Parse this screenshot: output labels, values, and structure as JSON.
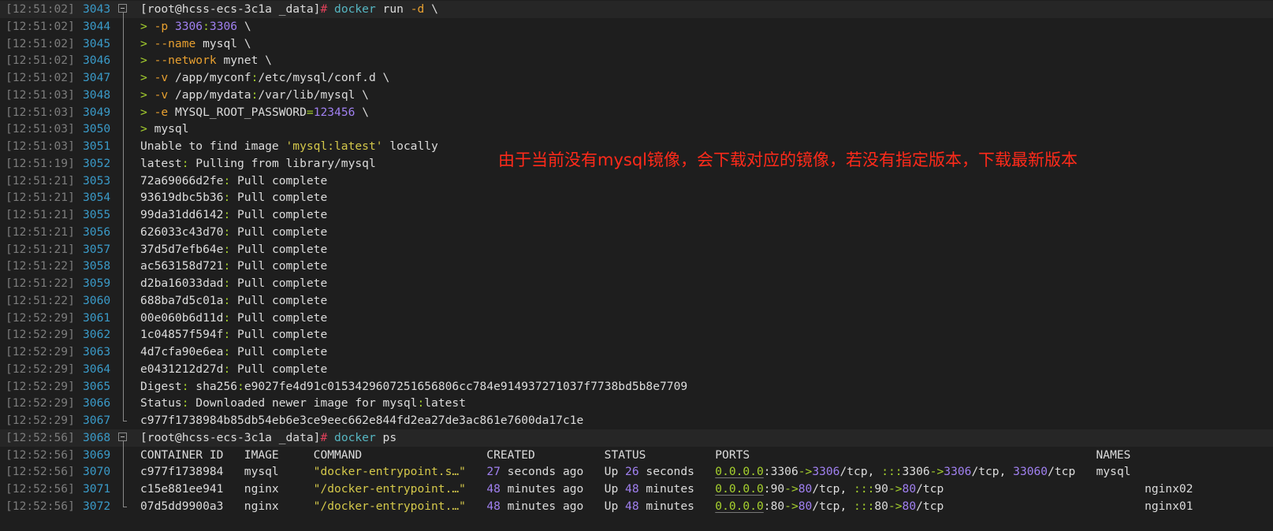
{
  "colors": {
    "background": "#1e1e1e",
    "timestamp": "#7c7c7c",
    "line_number": "#3a9ac8",
    "annotation": "#ff2a1a"
  },
  "annotation": "由于当前没有mysql镜像，会下载对应的镜像，若没有指定版本，下载最新版本",
  "lines": [
    {
      "ts": "[12:51:02]",
      "n": "3043",
      "fold": "start",
      "prompt": true,
      "seg": [
        [
          "[root@hcss-ecs-3c1a _data]",
          "w"
        ],
        [
          "#",
          "r"
        ],
        [
          " docker",
          "c"
        ],
        [
          " run ",
          "w"
        ],
        [
          "-d",
          "o"
        ],
        [
          " \\",
          "w"
        ]
      ]
    },
    {
      "ts": "[12:51:02]",
      "n": "3044",
      "fold": "mid",
      "seg": [
        [
          "> ",
          "g"
        ],
        [
          "-p",
          "o"
        ],
        [
          " ",
          "w"
        ],
        [
          "3306",
          "p"
        ],
        [
          ":",
          "g"
        ],
        [
          "3306",
          "p"
        ],
        [
          " \\",
          "w"
        ]
      ]
    },
    {
      "ts": "[12:51:02]",
      "n": "3045",
      "fold": "mid",
      "seg": [
        [
          "> ",
          "g"
        ],
        [
          "--name",
          "o"
        ],
        [
          " mysql \\",
          "w"
        ]
      ]
    },
    {
      "ts": "[12:51:02]",
      "n": "3046",
      "fold": "mid",
      "seg": [
        [
          "> ",
          "g"
        ],
        [
          "--network",
          "o"
        ],
        [
          " mynet \\",
          "w"
        ]
      ]
    },
    {
      "ts": "[12:51:02]",
      "n": "3047",
      "fold": "mid",
      "seg": [
        [
          "> ",
          "g"
        ],
        [
          "-v",
          "o"
        ],
        [
          " /app/myconf",
          "w"
        ],
        [
          ":",
          "g"
        ],
        [
          "/etc/mysql/conf.d \\",
          "w"
        ]
      ]
    },
    {
      "ts": "[12:51:03]",
      "n": "3048",
      "fold": "mid",
      "seg": [
        [
          "> ",
          "g"
        ],
        [
          "-v",
          "o"
        ],
        [
          " /app/mydata",
          "w"
        ],
        [
          ":",
          "g"
        ],
        [
          "/var/lib/mysql \\",
          "w"
        ]
      ]
    },
    {
      "ts": "[12:51:03]",
      "n": "3049",
      "fold": "mid",
      "seg": [
        [
          "> ",
          "g"
        ],
        [
          "-e",
          "o"
        ],
        [
          " MYSQL_ROOT_PASSWORD",
          "w"
        ],
        [
          "=",
          "g"
        ],
        [
          "123456",
          "p"
        ],
        [
          " \\",
          "w"
        ]
      ]
    },
    {
      "ts": "[12:51:03]",
      "n": "3050",
      "fold": "mid",
      "seg": [
        [
          "> ",
          "g"
        ],
        [
          "mysql",
          "w"
        ]
      ]
    },
    {
      "ts": "[12:51:03]",
      "n": "3051",
      "fold": "mid",
      "seg": [
        [
          "Unable to find image ",
          "w"
        ],
        [
          "'mysql:latest'",
          "y"
        ],
        [
          " locally",
          "w"
        ]
      ]
    },
    {
      "ts": "[12:51:19]",
      "n": "3052",
      "fold": "mid",
      "seg": [
        [
          "latest",
          "w"
        ],
        [
          ":",
          "g"
        ],
        [
          " Pulling from library/mysql",
          "w"
        ]
      ]
    },
    {
      "ts": "[12:51:21]",
      "n": "3053",
      "fold": "mid",
      "seg": [
        [
          "72a69066d2fe",
          "w"
        ],
        [
          ":",
          "g"
        ],
        [
          " Pull complete",
          "w"
        ]
      ]
    },
    {
      "ts": "[12:51:21]",
      "n": "3054",
      "fold": "mid",
      "seg": [
        [
          "93619dbc5b36",
          "w"
        ],
        [
          ":",
          "g"
        ],
        [
          " Pull complete",
          "w"
        ]
      ]
    },
    {
      "ts": "[12:51:21]",
      "n": "3055",
      "fold": "mid",
      "seg": [
        [
          "99da31dd6142",
          "w"
        ],
        [
          ":",
          "g"
        ],
        [
          " Pull complete",
          "w"
        ]
      ]
    },
    {
      "ts": "[12:51:21]",
      "n": "3056",
      "fold": "mid",
      "seg": [
        [
          "626033c43d70",
          "w"
        ],
        [
          ":",
          "g"
        ],
        [
          " Pull complete",
          "w"
        ]
      ]
    },
    {
      "ts": "[12:51:21]",
      "n": "3057",
      "fold": "mid",
      "seg": [
        [
          "37d5d7efb64e",
          "w"
        ],
        [
          ":",
          "g"
        ],
        [
          " Pull complete",
          "w"
        ]
      ]
    },
    {
      "ts": "[12:51:22]",
      "n": "3058",
      "fold": "mid",
      "seg": [
        [
          "ac563158d721",
          "w"
        ],
        [
          ":",
          "g"
        ],
        [
          " Pull complete",
          "w"
        ]
      ]
    },
    {
      "ts": "[12:51:22]",
      "n": "3059",
      "fold": "mid",
      "seg": [
        [
          "d2ba16033dad",
          "w"
        ],
        [
          ":",
          "g"
        ],
        [
          " Pull complete",
          "w"
        ]
      ]
    },
    {
      "ts": "[12:51:22]",
      "n": "3060",
      "fold": "mid",
      "seg": [
        [
          "688ba7d5c01a",
          "w"
        ],
        [
          ":",
          "g"
        ],
        [
          " Pull complete",
          "w"
        ]
      ]
    },
    {
      "ts": "[12:52:29]",
      "n": "3061",
      "fold": "mid",
      "seg": [
        [
          "00e060b6d11d",
          "w"
        ],
        [
          ":",
          "g"
        ],
        [
          " Pull complete",
          "w"
        ]
      ]
    },
    {
      "ts": "[12:52:29]",
      "n": "3062",
      "fold": "mid",
      "seg": [
        [
          "1c04857f594f",
          "w"
        ],
        [
          ":",
          "g"
        ],
        [
          " Pull complete",
          "w"
        ]
      ]
    },
    {
      "ts": "[12:52:29]",
      "n": "3063",
      "fold": "mid",
      "seg": [
        [
          "4d7cfa90e6ea",
          "w"
        ],
        [
          ":",
          "g"
        ],
        [
          " Pull complete",
          "w"
        ]
      ]
    },
    {
      "ts": "[12:52:29]",
      "n": "3064",
      "fold": "mid",
      "seg": [
        [
          "e0431212d27d",
          "w"
        ],
        [
          ":",
          "g"
        ],
        [
          " Pull complete",
          "w"
        ]
      ]
    },
    {
      "ts": "[12:52:29]",
      "n": "3065",
      "fold": "mid",
      "seg": [
        [
          "Digest",
          "w"
        ],
        [
          ":",
          "g"
        ],
        [
          " sha256",
          "w"
        ],
        [
          ":",
          "g"
        ],
        [
          "e9027fe4d91c0153429607251656806cc784e914937271037f7738bd5b8e7709",
          "w"
        ]
      ]
    },
    {
      "ts": "[12:52:29]",
      "n": "3066",
      "fold": "mid",
      "seg": [
        [
          "Status",
          "w"
        ],
        [
          ":",
          "g"
        ],
        [
          " Downloaded newer image for mysql",
          "w"
        ],
        [
          ":",
          "g"
        ],
        [
          "latest",
          "w"
        ]
      ]
    },
    {
      "ts": "[12:52:29]",
      "n": "3067",
      "fold": "end",
      "seg": [
        [
          "c977f1738984b85db54eb6e3ce9eec662e844fd2ea27de3ac861e7600da17c1e",
          "w"
        ]
      ]
    },
    {
      "ts": "[12:52:56]",
      "n": "3068",
      "fold": "start",
      "prompt": true,
      "seg": [
        [
          "[root@hcss-ecs-3c1a _data]",
          "w"
        ],
        [
          "#",
          "r"
        ],
        [
          " docker",
          "c"
        ],
        [
          " ps",
          "w"
        ]
      ]
    },
    {
      "ts": "[12:52:56]",
      "n": "3069",
      "fold": "mid",
      "seg": [
        [
          "CONTAINER ID   IMAGE     COMMAND                  CREATED          STATUS          PORTS                                                  NAMES",
          "w"
        ]
      ]
    },
    {
      "ts": "[12:52:56]",
      "n": "3070",
      "fold": "mid",
      "seg": [
        [
          "c977f1738984   mysql     ",
          "w"
        ],
        [
          "\"docker-entrypoint.s…\"",
          "y"
        ],
        [
          "   ",
          "w"
        ],
        [
          "27",
          "p"
        ],
        [
          " seconds ago   Up ",
          "w"
        ],
        [
          "26",
          "p"
        ],
        [
          " seconds   ",
          "w"
        ],
        [
          "0.0.0.0",
          "u"
        ],
        [
          ":3306",
          "w"
        ],
        [
          "->",
          "g"
        ],
        [
          "3306",
          "p"
        ],
        [
          "/tcp, ",
          "w"
        ],
        [
          ":::",
          "g"
        ],
        [
          "3306",
          "w"
        ],
        [
          "->",
          "g"
        ],
        [
          "3306",
          "p"
        ],
        [
          "/tcp, ",
          "w"
        ],
        [
          "33060",
          "p"
        ],
        [
          "/tcp   mysql",
          "w"
        ]
      ]
    },
    {
      "ts": "[12:52:56]",
      "n": "3071",
      "fold": "mid",
      "seg": [
        [
          "c15e881ee941   nginx     ",
          "w"
        ],
        [
          "\"/docker-entrypoint.…\"",
          "y"
        ],
        [
          "   ",
          "w"
        ],
        [
          "48",
          "p"
        ],
        [
          " minutes ago   Up ",
          "w"
        ],
        [
          "48",
          "p"
        ],
        [
          " minutes   ",
          "w"
        ],
        [
          "0.0.0.0",
          "u"
        ],
        [
          ":90",
          "w"
        ],
        [
          "->",
          "g"
        ],
        [
          "80",
          "p"
        ],
        [
          "/tcp, ",
          "w"
        ],
        [
          ":::",
          "g"
        ],
        [
          "90",
          "w"
        ],
        [
          "->",
          "g"
        ],
        [
          "80",
          "p"
        ],
        [
          "/tcp                             nginx02",
          "w"
        ]
      ]
    },
    {
      "ts": "[12:52:56]",
      "n": "3072",
      "fold": "end",
      "seg": [
        [
          "07d5dd9900a3   nginx     ",
          "w"
        ],
        [
          "\"/docker-entrypoint.…\"",
          "y"
        ],
        [
          "   ",
          "w"
        ],
        [
          "48",
          "p"
        ],
        [
          " minutes ago   Up ",
          "w"
        ],
        [
          "48",
          "p"
        ],
        [
          " minutes   ",
          "w"
        ],
        [
          "0.0.0.0",
          "u"
        ],
        [
          ":80",
          "w"
        ],
        [
          "->",
          "g"
        ],
        [
          "80",
          "p"
        ],
        [
          "/tcp, ",
          "w"
        ],
        [
          ":::",
          "g"
        ],
        [
          "80",
          "w"
        ],
        [
          "->",
          "g"
        ],
        [
          "80",
          "p"
        ],
        [
          "/tcp                             nginx01",
          "w"
        ]
      ]
    }
  ]
}
